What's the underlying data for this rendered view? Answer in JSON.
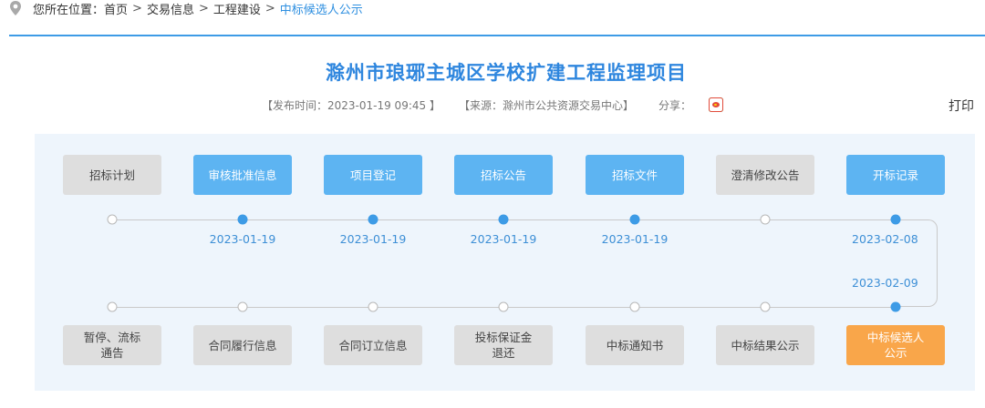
{
  "breadcrumb": {
    "prefix": "您所在位置：",
    "separator": ">",
    "items": [
      "首页",
      "交易信息",
      "工程建设"
    ],
    "current": "中标候选人公示"
  },
  "article": {
    "title": "滁州市琅琊主城区学校扩建工程监理项目",
    "publish": "【发布时间：2023-01-19 09:45 】",
    "source": "【来源：滁州市公共资源交易中心】",
    "share_label": "分享：",
    "share_icons": [
      "wechat-icon",
      "weibo-icon"
    ],
    "print_label": "打印"
  },
  "flow": {
    "top": [
      {
        "label": "招标计划",
        "state": "inactive",
        "date": ""
      },
      {
        "label": "审核批准信息",
        "state": "done",
        "date": "2023-01-19"
      },
      {
        "label": "项目登记",
        "state": "done",
        "date": "2023-01-19"
      },
      {
        "label": "招标公告",
        "state": "done",
        "date": "2023-01-19"
      },
      {
        "label": "招标文件",
        "state": "done",
        "date": "2023-01-19"
      },
      {
        "label": "澄清修改公告",
        "state": "inactive",
        "date": ""
      },
      {
        "label": "开标记录",
        "state": "done",
        "date": "2023-02-08"
      }
    ],
    "bottom": [
      {
        "label": "暂停、流标\n通告",
        "state": "inactive",
        "date": ""
      },
      {
        "label": "合同履行信息",
        "state": "inactive",
        "date": ""
      },
      {
        "label": "合同订立信息",
        "state": "inactive",
        "date": ""
      },
      {
        "label": "投标保证金\n退还",
        "state": "inactive",
        "date": ""
      },
      {
        "label": "中标通知书",
        "state": "inactive",
        "date": ""
      },
      {
        "label": "中标结果公示",
        "state": "inactive",
        "date": ""
      },
      {
        "label": "中标候选人\n公示",
        "state": "current",
        "date": "2023-02-09"
      }
    ]
  },
  "colors": {
    "accent": "#3d9be6",
    "done_button": "#5db4f2",
    "current_button": "#f9a64a",
    "inactive_button": "#dedede",
    "panel_bg": "#eef5fc"
  }
}
